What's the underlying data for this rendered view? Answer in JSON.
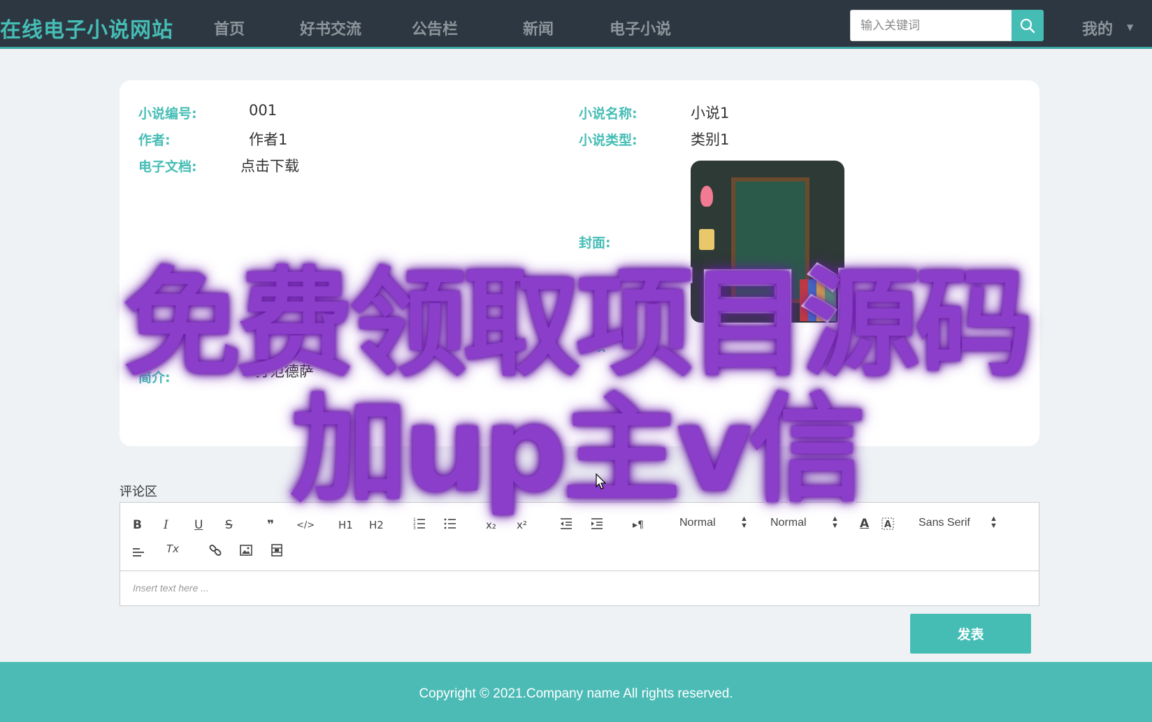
{
  "nav": {
    "brand": "在线电子小说网站",
    "items": [
      {
        "label": "首页"
      },
      {
        "label": "好书交流"
      },
      {
        "label": "公告栏"
      },
      {
        "label": "新闻"
      },
      {
        "label": "电子小说"
      }
    ],
    "search_placeholder": "输入关键词",
    "my_label": "我的"
  },
  "novel": {
    "id_label": "小说编号:",
    "id_value": "001",
    "name_label": "小说名称:",
    "name_value": "小说1",
    "author_label": "作者:",
    "author_value": "作者1",
    "type_label": "小说类型:",
    "type_value": "类别1",
    "doc_label": "电子文档:",
    "doc_value": "点击下载",
    "cover_label": "封面:",
    "clicks_label": "点数",
    "intro_label": "简介:",
    "intro_value": "手打范德萨"
  },
  "comments": {
    "title": "评论区",
    "toolbar": {
      "bold": "B",
      "italic": "I",
      "underline": "U",
      "strike": "S",
      "blockquote": "❞",
      "code": "</>",
      "h1": "H1",
      "h2": "H2",
      "sub": "x₂",
      "sup": "x²",
      "rtl": "▸¶",
      "size_select": "Normal",
      "header_select": "Normal",
      "font_select": "Sans Serif",
      "color": "A",
      "clean": "Tx"
    },
    "placeholder": "Insert text here ...",
    "publish": "发表"
  },
  "footer": {
    "copyright": "Copyright © 2021.Company name All rights reserved."
  },
  "overlay": {
    "line1": "免费领取项目源码",
    "line2": "加up主v信"
  }
}
